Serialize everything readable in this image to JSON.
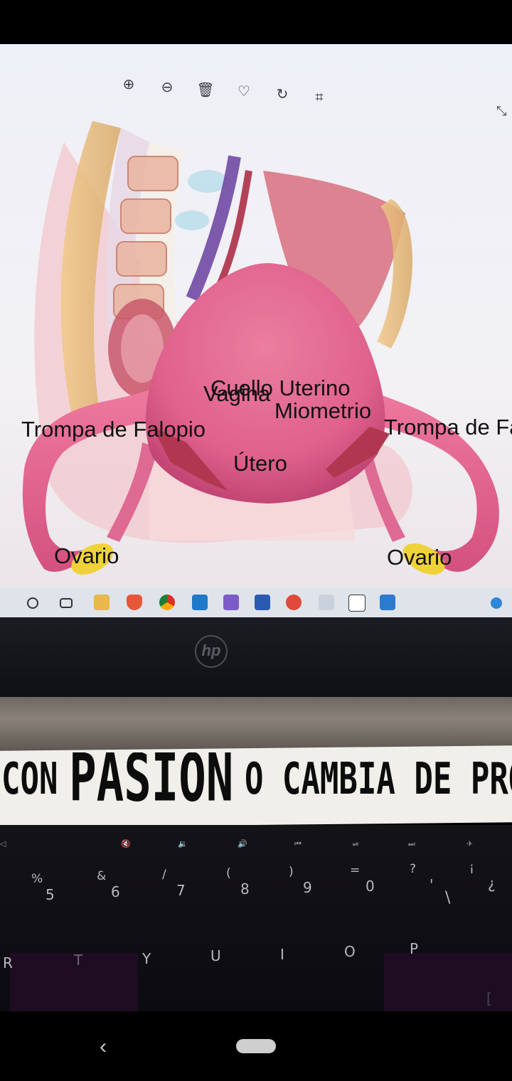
{
  "ar_labels": {
    "trompa_izq": "Trompa de Falopio",
    "trompa_der": "Trompa de Falopio",
    "ovario_izq": "Ovario",
    "ovario_der": "Ovario",
    "cuello_uterino": "Cuello Uterino",
    "vagina": "Vagina",
    "miometrio": "Miometrio",
    "utero": "Útero"
  },
  "tape": {
    "word_small": "CON",
    "word_big": "PASION",
    "rest": "O CAMBIA DE PROFE"
  },
  "keyboard": {
    "number_row": [
      {
        "top": "%",
        "bottom": "5"
      },
      {
        "top": "&",
        "bottom": "6"
      },
      {
        "top": "/",
        "bottom": "7"
      },
      {
        "top": "(",
        "bottom": "8"
      },
      {
        "top": ")",
        "bottom": "9"
      },
      {
        "top": "=",
        "bottom": "0"
      },
      {
        "top": "?",
        "bottom": "'"
      },
      {
        "top": "¡",
        "bottom": "¿"
      }
    ],
    "letter_row": [
      "R",
      "T",
      "Y",
      "U",
      "I",
      "O",
      "P",
      "["
    ]
  },
  "laptop_brand": "hp",
  "icons": {
    "toolbar": [
      "zoom-in-icon",
      "zoom-out-icon",
      "trash-icon",
      "heart-icon",
      "rotate-icon",
      "crop-icon"
    ],
    "taskbar": [
      "start-circle-icon",
      "task-view-icon",
      "file-explorer-icon",
      "brave-icon",
      "chrome-icon",
      "vscode-icon",
      "visual-studio-icon",
      "word-icon",
      "media-icon",
      "store-icon",
      "notion-icon",
      "photos-icon"
    ],
    "nav": [
      "back-icon",
      "home-pill"
    ]
  },
  "colors": {
    "uterus_pink": "#e2628c",
    "ovary_yellow": "#efd23a",
    "label_text": "#111111"
  }
}
